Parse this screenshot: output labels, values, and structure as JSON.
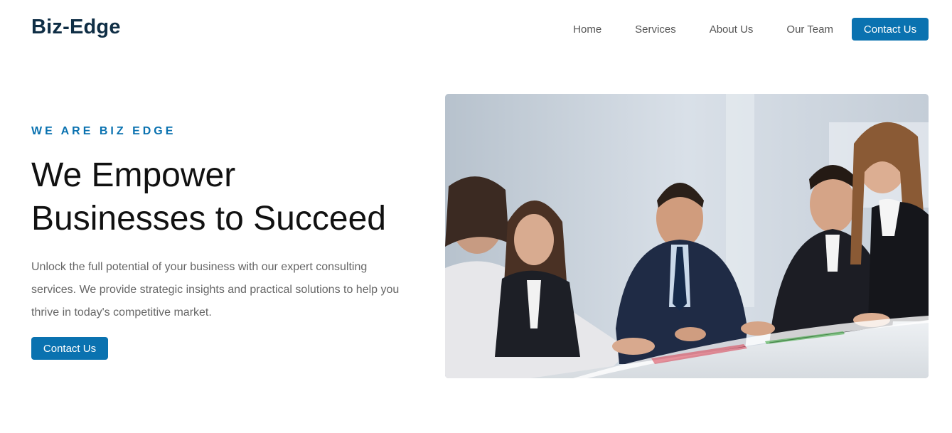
{
  "header": {
    "logo": "Biz-Edge",
    "nav": [
      {
        "label": "Home"
      },
      {
        "label": "Services"
      },
      {
        "label": "About Us"
      },
      {
        "label": "Our Team"
      }
    ],
    "contact_button": "Contact Us"
  },
  "hero": {
    "eyebrow": "WE ARE BIZ EDGE",
    "headline_line1": "We Empower",
    "headline_line2": "Businesses to Succeed",
    "description": "Unlock the full potential of your business with our expert consulting services. We provide strategic insights and practical solutions to help you thrive in today's competitive market.",
    "cta_button": "Contact Us",
    "image_subject": "business-team-meeting-photo"
  },
  "colors": {
    "accent": "#0a72b0",
    "logo": "#0f2e45",
    "body_text": "#666666"
  }
}
